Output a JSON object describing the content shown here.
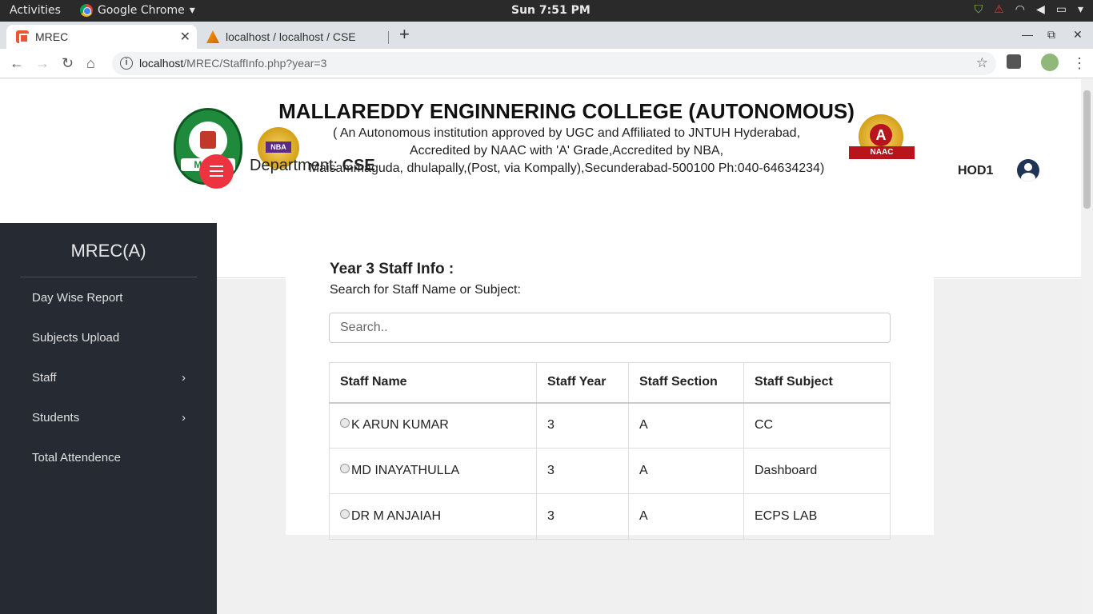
{
  "os_bar": {
    "activities": "Activities",
    "app_name": "Google Chrome",
    "clock": "Sun  7:51 PM"
  },
  "browser": {
    "tabs": [
      {
        "title": "MREC",
        "active": true
      },
      {
        "title": "localhost / localhost / CSE",
        "active": false
      }
    ],
    "url_host": "localhost",
    "url_path": "/MREC/StaffInfo.php?year=3"
  },
  "header": {
    "college_name": "MALLAREDDY ENGINNERING COLLEGE (AUTONOMOUS)",
    "line1": "( An Autonomous institution approved by UGC and Affiliated to JNTUH Hyderabad,",
    "line2": "Accredited by NAAC with 'A' Grade,Accredited by NBA,",
    "line3": "Maisammaguda, dhulapally,(Post, via Kompally),Secunderabad-500100 Ph:040-64634234)",
    "logo_left_text": "MREC",
    "nba_text": "NBA",
    "naac_grade": "A",
    "naac_text": "NAAC"
  },
  "sidebar": {
    "brand": "MREC(A)",
    "items": [
      {
        "label": "Day Wise Report",
        "has_submenu": false
      },
      {
        "label": "Subjects Upload",
        "has_submenu": false
      },
      {
        "label": "Staff",
        "has_submenu": true
      },
      {
        "label": "Students",
        "has_submenu": true
      },
      {
        "label": "Total Attendence",
        "has_submenu": false
      }
    ]
  },
  "topnav": {
    "dept_label": "Department:",
    "dept_value": "CSE",
    "user": "HOD1"
  },
  "main": {
    "title": "Year 3 Staff Info :",
    "subtitle": "Search for Staff Name or Subject:",
    "search_placeholder": "Search..",
    "table": {
      "headers": [
        "Staff Name",
        "Staff Year",
        "Staff Section",
        "Staff Subject"
      ],
      "rows": [
        [
          "K ARUN KUMAR",
          "3",
          "A",
          "CC"
        ],
        [
          "MD INAYATHULLA",
          "3",
          "A",
          "Dashboard"
        ],
        [
          "DR M ANJAIAH",
          "3",
          "A",
          "ECPS LAB"
        ]
      ]
    }
  },
  "colors": {
    "sidebar_bg": "#262a33",
    "toggle_accent": "#ee3340",
    "content_bg": "#f0f0f0"
  }
}
